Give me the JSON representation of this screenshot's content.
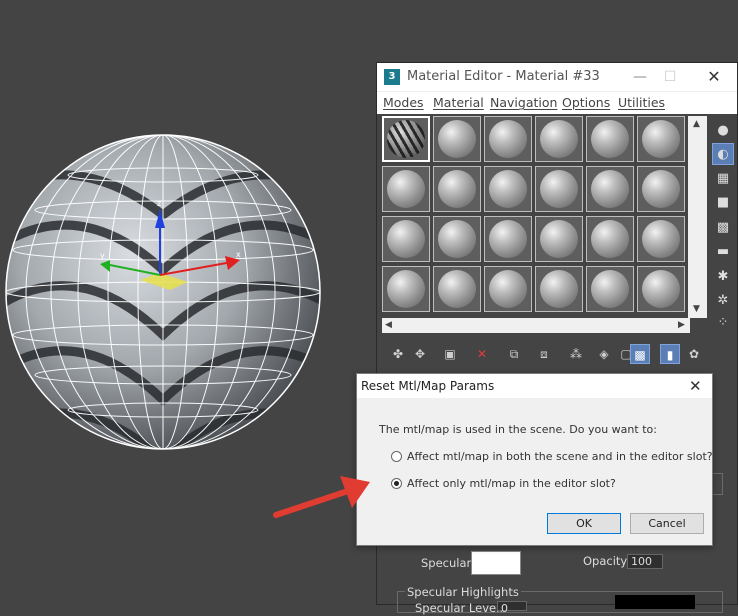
{
  "material_editor": {
    "title": "Material Editor - Material #33",
    "logo": "3",
    "window_controls": {
      "minimize": "—",
      "maximize": "☐",
      "close": "✕"
    },
    "menu": [
      "Modes",
      "Material",
      "Navigation",
      "Options",
      "Utilities"
    ],
    "slots": {
      "rows": 4,
      "cols": 6,
      "active_index": 0
    },
    "side_tools": [
      "sphere-icon",
      "backlight-icon",
      "checker-icon",
      "bg-color-icon",
      "color-check-icon",
      "video-icon",
      "make-preview-icon",
      "options-icon",
      "more-icon"
    ],
    "bottom_toolbar": [
      "get-material-icon",
      "put-to-scene-icon",
      "assign-icon",
      "reset-icon",
      "copy-icon",
      "unique-icon",
      "library-icon",
      "effects-channel-icon",
      "show-map-icon",
      "show-end-icon",
      "go-parent-icon",
      "go-sibling-icon"
    ],
    "params": {
      "specular_label": "Specular:",
      "opacity_label": "Opacity:",
      "opacity_value": "100",
      "specular_highlights_label": "Specular Highlights",
      "specular_level_label": "Specular Level:",
      "specular_level_value": "0"
    }
  },
  "dialog": {
    "title": "Reset Mtl/Map Params",
    "close": "✕",
    "message": "The mtl/map is used in the scene. Do you want to:",
    "options": [
      {
        "label": "Affect mtl/map in both the scene and in the editor slot?",
        "checked": false
      },
      {
        "label": "Affect only mtl/map in the editor slot?",
        "checked": true
      }
    ],
    "ok_label": "OK",
    "cancel_label": "Cancel"
  },
  "colors": {
    "viewport_bg": "#444444",
    "arrow": "#e03c31",
    "gizmo_x": "#e02020",
    "gizmo_y": "#20b020",
    "gizmo_z": "#2040e0"
  }
}
